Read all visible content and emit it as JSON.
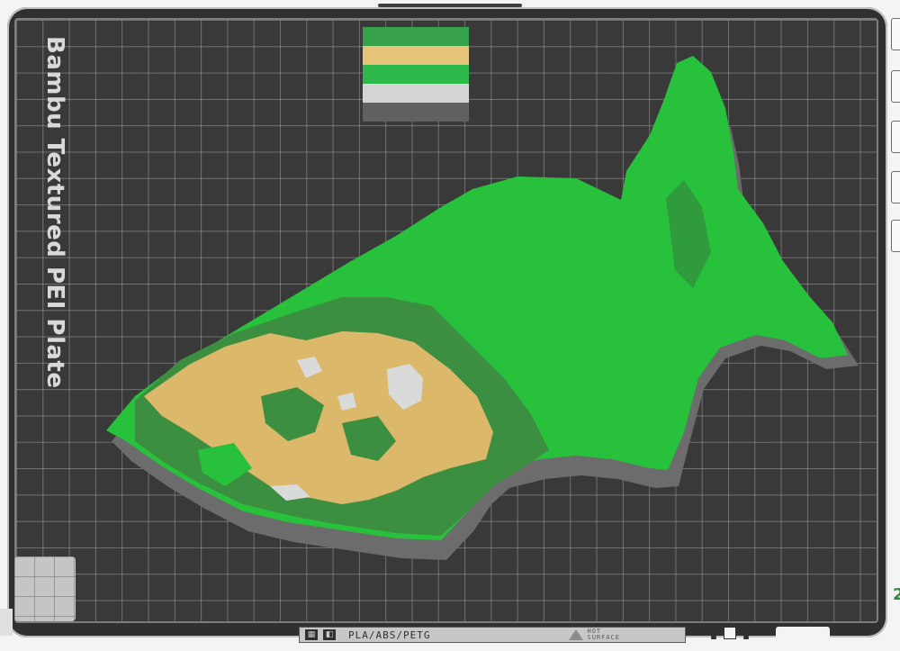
{
  "plate": {
    "name": "Bambu Textured PEI Plate",
    "material_label": "PLA/ABS/PETG",
    "hot_surface_label": "HOT\nSURFACE"
  },
  "color_key": {
    "swatches": [
      "#36a04a",
      "#e6c57a",
      "#2fb84a",
      "#d4d5d4",
      "#5f605f"
    ]
  },
  "colors": {
    "plate_background": "#2f302f",
    "grid_line": "#b4b6b4",
    "lowland_green": "#27c13c",
    "midland_green": "#3c8f40",
    "highland_tan": "#dbb86a",
    "peak_white": "#d9dada",
    "model_side": "#6b6c6b"
  },
  "toolbar_right": {
    "icons": [
      "arrange-icon",
      "orient-icon",
      "split-icon",
      "layer-icon",
      "expand-icon"
    ]
  },
  "bottom_icons": [
    "grid-layout-icon",
    "plate-icon",
    "upload-icon",
    "square-icon",
    "upload-icon-2"
  ],
  "partial_edge_text": "2"
}
